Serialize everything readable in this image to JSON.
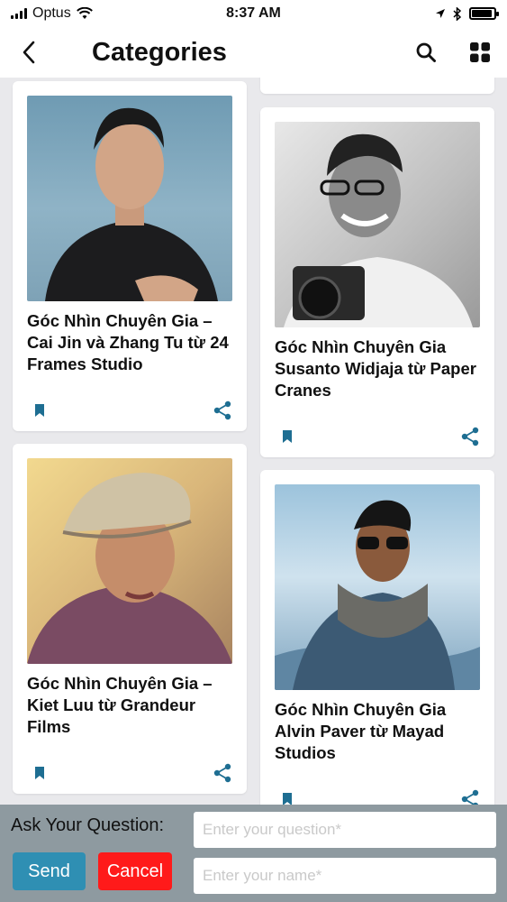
{
  "status_bar": {
    "carrier": "Optus",
    "time": "8:37 AM"
  },
  "header": {
    "title": "Categories"
  },
  "cards": [
    {
      "title": "Góc Nhìn Chuyên Gia – Cai Jin và Zhang Tu từ 24 Frames Studio"
    },
    {
      "title": "Góc Nhìn Chuyên Gia Susanto Widjaja từ Paper Cranes"
    },
    {
      "title": "Góc Nhìn Chuyên Gia – Kiet Luu từ Grandeur Films"
    },
    {
      "title": "Góc Nhìn Chuyên Gia Alvin Paver từ Mayad Studios"
    }
  ],
  "question_bar": {
    "label": "Ask Your Question:",
    "question_placeholder": "Enter your question*",
    "name_placeholder": "Enter your name*",
    "send_label": "Send",
    "cancel_label": "Cancel"
  },
  "colors": {
    "accent": "#1e6e92",
    "send": "#2f8fb3",
    "cancel": "#ff1a1a",
    "question_bar": "#8e9aa0"
  },
  "icons": [
    "back-arrow-icon",
    "search-icon",
    "grid-icon",
    "bookmark-icon",
    "share-icon",
    "wifi-icon",
    "location-icon",
    "bluetooth-icon",
    "battery-icon"
  ]
}
